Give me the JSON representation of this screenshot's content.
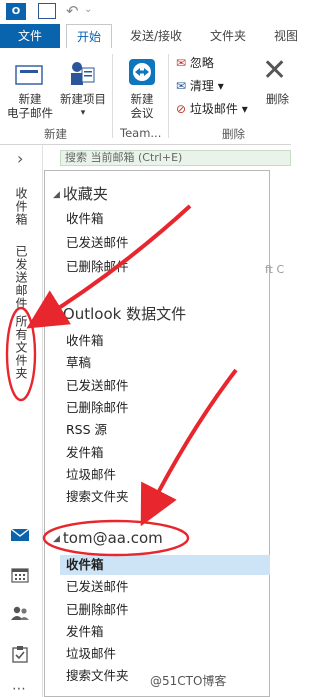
{
  "quick_access": {
    "app_icon_text": "O⊡"
  },
  "tabs": {
    "file": "文件",
    "home": "开始",
    "send_receive": "发送/接收",
    "folder": "文件夹",
    "view": "视图"
  },
  "ribbon": {
    "new_email": [
      "新建",
      "电子邮件"
    ],
    "new_items": [
      "新建项目",
      "▾"
    ],
    "new_meeting": [
      "新建",
      "会议"
    ],
    "ignore": "忽略",
    "cleanup": "清理 ▾",
    "junk": "垃圾邮件 ▾",
    "delete": "删除",
    "groups": {
      "new": "新建",
      "teamviewer": "Team...",
      "delete": "删除"
    }
  },
  "rail": {
    "expand": "›",
    "items": [
      "收件箱",
      "已发送邮件",
      "所有文件夹"
    ],
    "bottom_icons": [
      "mail-icon",
      "calendar-icon",
      "people-icon",
      "tasks-icon",
      "more-icon"
    ]
  },
  "search": {
    "placeholder": "搜索 当前邮箱 (Ctrl+E)"
  },
  "folders": {
    "favorites": {
      "title": "收藏夹",
      "items": [
        "收件箱",
        "已发送邮件",
        "已删除邮件"
      ]
    },
    "outlook_data": {
      "title": "Outlook 数据文件",
      "items": [
        "收件箱",
        "草稿",
        "已发送邮件",
        "已删除邮件",
        "RSS 源",
        "发件箱",
        "垃圾邮件",
        "搜索文件夹"
      ]
    },
    "account": {
      "title": "tom@aa.com",
      "items": [
        "收件箱",
        "已发送邮件",
        "已删除邮件",
        "发件箱",
        "垃圾邮件",
        "搜索文件夹"
      ],
      "selected_index": 0
    }
  },
  "right_snippets": [
    "ft C"
  ],
  "watermark": "@51CTO博客",
  "colors": {
    "accent": "#0a64ad",
    "selection": "#cde4f7",
    "annotation": "#e8262d"
  }
}
